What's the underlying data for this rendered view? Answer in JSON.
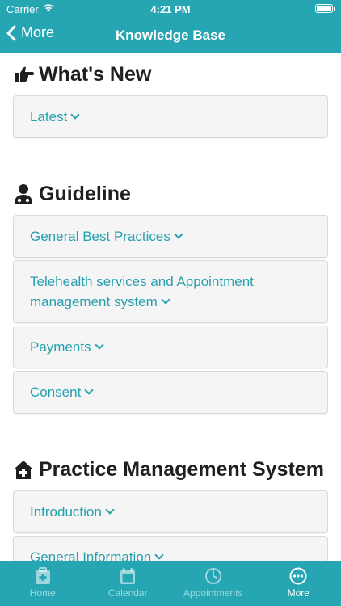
{
  "status": {
    "carrier": "Carrier",
    "time": "4:21 PM"
  },
  "nav": {
    "back_label": "More",
    "title": "Knowledge Base"
  },
  "sections": [
    {
      "title": "What's New",
      "icon": "hand-pointing-right-icon",
      "items": [
        "Latest"
      ]
    },
    {
      "title": "Guideline",
      "icon": "user-doctor-icon",
      "items": [
        "General Best Practices",
        "Telehealth services and Appointment management system",
        "Payments",
        "Consent"
      ]
    },
    {
      "title": "Practice Management System",
      "icon": "clinic-house-icon",
      "items": [
        "Introduction",
        "General Information"
      ]
    }
  ],
  "tabs": [
    {
      "label": "Home",
      "icon": "medical-kit-icon",
      "active": false
    },
    {
      "label": "Calendar",
      "icon": "calendar-icon",
      "active": false
    },
    {
      "label": "Appointments",
      "icon": "clock-icon",
      "active": false
    },
    {
      "label": "More",
      "icon": "more-dots-icon",
      "active": true
    }
  ],
  "colors": {
    "brand": "#26a6b3",
    "link": "#25a0ad"
  }
}
